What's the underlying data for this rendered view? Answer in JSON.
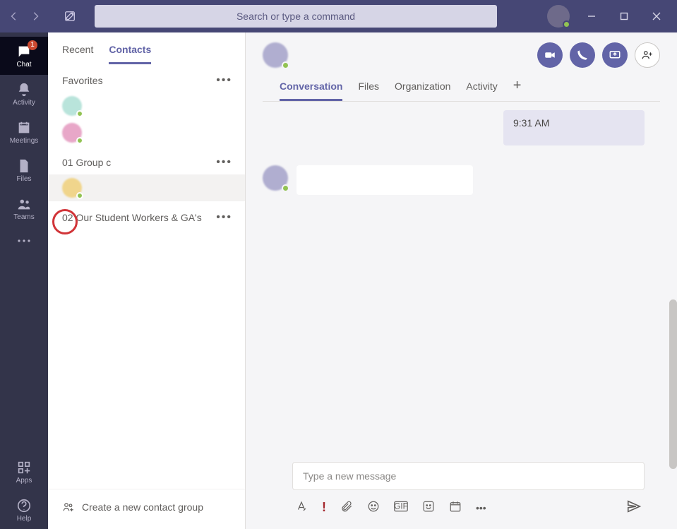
{
  "search_placeholder": "Search or type a command",
  "rail": {
    "chat": "Chat",
    "chat_badge": "1",
    "activity": "Activity",
    "meetings": "Meetings",
    "files": "Files",
    "teams": "Teams",
    "apps": "Apps",
    "help": "Help"
  },
  "list_tabs": {
    "recent": "Recent",
    "contacts": "Contacts"
  },
  "groups": [
    {
      "name": "Favorites"
    },
    {
      "name": "01 Group c"
    },
    {
      "name": "02 Our Student Workers & GA's"
    }
  ],
  "create_group": "Create a new contact group",
  "chat_tabs": {
    "conversation": "Conversation",
    "files": "Files",
    "organization": "Organization",
    "activity": "Activity"
  },
  "msg_out_time": "9:31 AM",
  "compose_placeholder": "Type a new message"
}
